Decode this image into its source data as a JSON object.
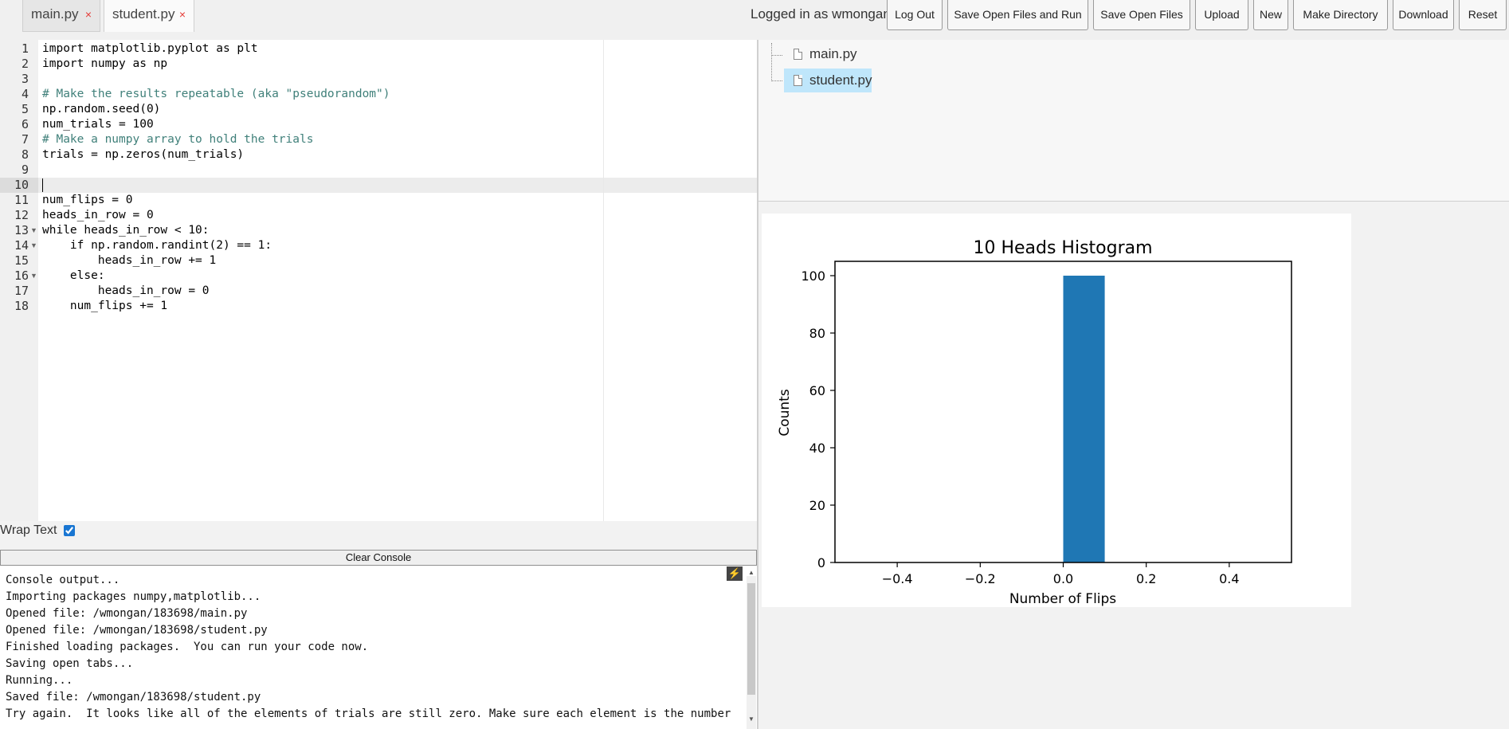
{
  "tabs": [
    {
      "label": "main.py",
      "close": "×"
    },
    {
      "label": "student.py",
      "close": "×"
    }
  ],
  "header": {
    "logged_in": "Logged in as wmongan",
    "buttons": [
      "Log Out",
      "Save Open Files and Run",
      "Save Open Files",
      "Upload",
      "New",
      "Make Directory",
      "Download",
      "Reset"
    ]
  },
  "editor": {
    "lines": [
      "import matplotlib.pyplot as plt",
      "import numpy as np",
      "",
      "# Make the results repeatable (aka \"pseudorandom\")",
      "np.random.seed(0)",
      "num_trials = 100",
      "# Make a numpy array to hold the trials",
      "trials = np.zeros(num_trials)",
      "",
      "",
      "num_flips = 0",
      "heads_in_row = 0",
      "while heads_in_row < 10:",
      "    if np.random.randint(2) == 1:",
      "        heads_in_row += 1",
      "    else:",
      "        heads_in_row = 0",
      "    num_flips += 1"
    ],
    "active_line": 10
  },
  "wrap_text": {
    "label": "Wrap Text",
    "checked": true
  },
  "console": {
    "clear_label": "Clear Console",
    "lines": [
      "Console output...",
      "Importing packages numpy,matplotlib...",
      "Opened file: /wmongan/183698/main.py",
      "Opened file: /wmongan/183698/student.py",
      "Finished loading packages.  You can run your code now.",
      "Saving open tabs...",
      "Running...",
      "Saved file: /wmongan/183698/student.py",
      "Try again.  It looks like all of the elements of trials are still zero. Make sure each element is the number"
    ]
  },
  "files": [
    {
      "name": "main.py",
      "selected": false
    },
    {
      "name": "student.py",
      "selected": true
    }
  ],
  "chart_data": {
    "type": "bar",
    "title": "10 Heads Histogram",
    "xlabel": "Number of Flips",
    "ylabel": "Counts",
    "bars": [
      {
        "x_start": 0.0,
        "x_end": 0.1,
        "count": 100
      }
    ],
    "xlim": [
      -0.55,
      0.55
    ],
    "ylim": [
      0,
      105
    ],
    "xticks": [
      -0.4,
      -0.2,
      0.0,
      0.2,
      0.4
    ],
    "xtick_labels": [
      "−0.4",
      "−0.2",
      "0.0",
      "0.2",
      "0.4"
    ],
    "yticks": [
      0,
      20,
      40,
      60,
      80,
      100
    ],
    "bar_color": "#1f77b4",
    "grid": false
  }
}
